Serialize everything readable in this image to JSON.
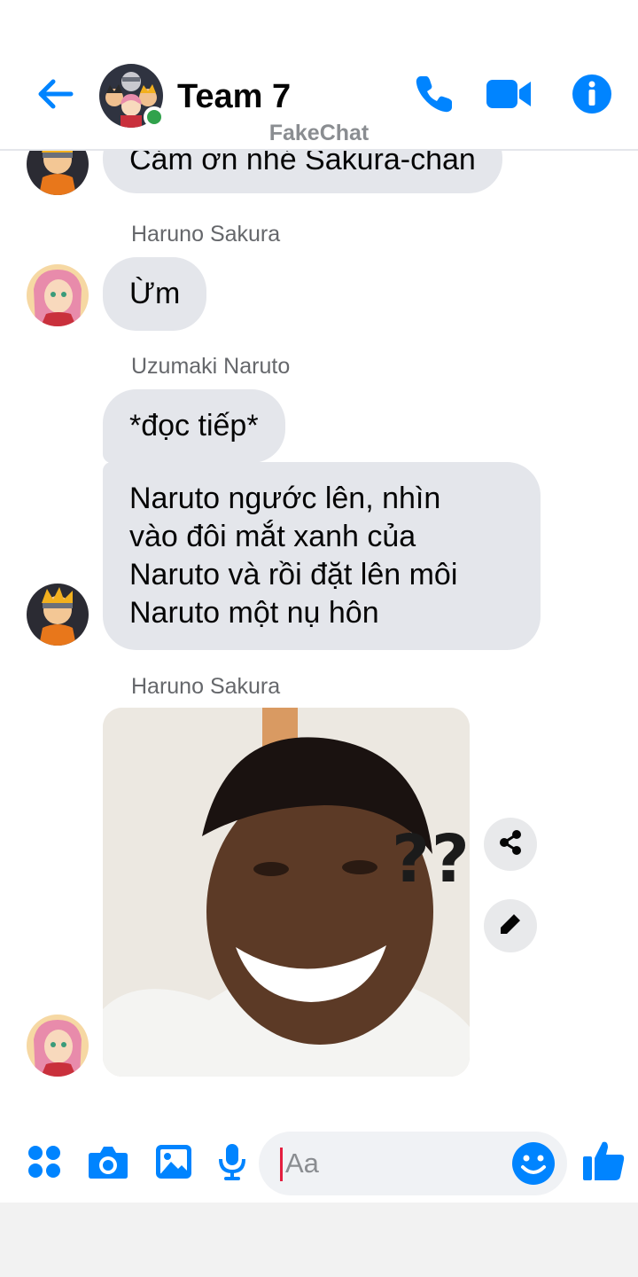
{
  "header": {
    "title": "Team 7",
    "watermark": "FakeChat",
    "icons": [
      "back-arrow-icon",
      "phone-icon",
      "video-camera-icon",
      "info-icon"
    ],
    "accent_color": "#0084ff",
    "online_color": "#31a24c"
  },
  "messages": [
    {
      "sender": "",
      "text": "Cảm ơn nhé Sakura-chan"
    },
    {
      "sender": "Haruno Sakura",
      "text": "Ừm"
    },
    {
      "sender": "Uzumaki Naruto",
      "text": "*đọc tiếp*"
    },
    {
      "sender": "",
      "text": "Naruto ngước lên, nhìn\nvào đôi mắt xanh của\nNaruto và rồi đặt lên môi\nNaruto một nụ hôn"
    },
    {
      "sender": "Haruno Sakura",
      "image_text": "???"
    }
  ],
  "composer": {
    "placeholder": "Aa",
    "icons": [
      "apps-icon",
      "camera-icon",
      "gallery-icon",
      "microphone-icon",
      "emoji-icon",
      "thumbs-up-icon"
    ]
  },
  "image_actions": [
    "share-icon",
    "edit-icon"
  ]
}
